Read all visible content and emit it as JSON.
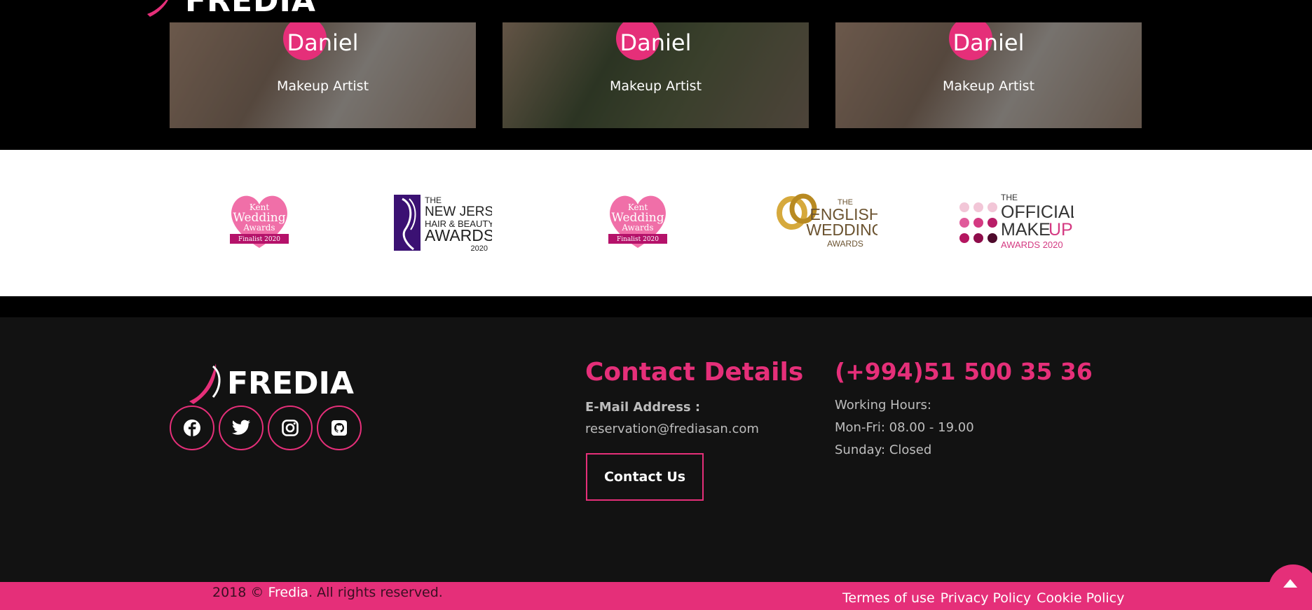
{
  "header": {
    "logo_text": "FREDIA"
  },
  "team": [
    {
      "name": "Daniel",
      "role": "Makeup Artist",
      "photo_tone": "#8a7a70"
    },
    {
      "name": "Daniel",
      "role": "Makeup Artist",
      "photo_tone": "#5a5f45"
    },
    {
      "name": "Daniel",
      "role": "Makeup Artist",
      "photo_tone": "#8a7a70"
    }
  ],
  "awards": [
    {
      "lines": [
        "Kent",
        "Wedding",
        "Awards",
        "Finalist 2020"
      ],
      "type": "heart"
    },
    {
      "lines": [
        "THE",
        "NEW JERSEY",
        "HAIR & BEAUTY",
        "AWARDS",
        "2020"
      ],
      "type": "nj"
    },
    {
      "lines": [
        "Kent",
        "Wedding",
        "Awards",
        "Finalist 2020"
      ],
      "type": "heart"
    },
    {
      "lines": [
        "THE",
        "ENGLISH",
        "WEDDING",
        "AWARDS"
      ],
      "type": "rings"
    },
    {
      "lines": [
        "THE",
        "OFFICIAL",
        "MAKE",
        "UP",
        "AWARDS 2020"
      ],
      "type": "dots"
    }
  ],
  "footer": {
    "logo_text": "FREDIA",
    "socials": [
      {
        "name": "facebook-icon"
      },
      {
        "name": "twitter-icon"
      },
      {
        "name": "instagram-icon"
      },
      {
        "name": "github-icon"
      }
    ],
    "contact_title": "Contact Details",
    "email_label": "E-Mail Address :",
    "email_value": "reservation@frediasan.com",
    "contact_button": "Contact Us",
    "phone": "(+994)51 500 35 36",
    "hours_label": "Working Hours:",
    "hours_weekdays": "Mon-Fri: 08.00 - 19.00",
    "hours_sunday": "Sunday: Closed"
  },
  "bottom": {
    "copy_prefix": "2018 ©",
    "copy_brand": "Fredia",
    "copy_suffix": ". All rights reserved.",
    "links": [
      "Termes of use",
      "Privacy Policy",
      "Cookie Policy"
    ]
  },
  "colors": {
    "accent": "#e52f79",
    "footer_bg": "#121212",
    "text_muted": "#bdbdbd"
  }
}
